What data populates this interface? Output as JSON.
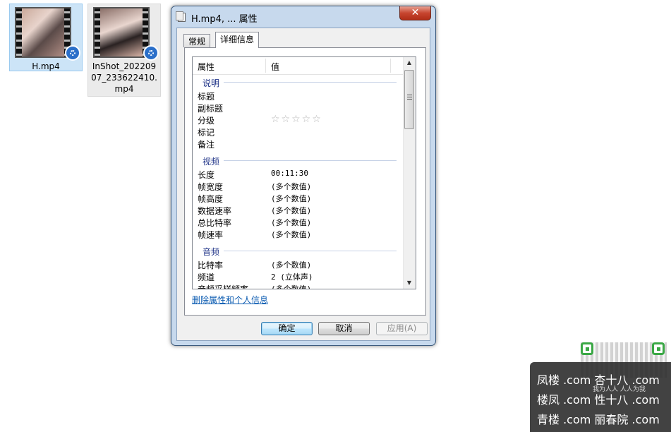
{
  "desktop": {
    "files": [
      {
        "name": "H.mp4"
      },
      {
        "name": "InShot_20220907_233622410.mp4"
      }
    ]
  },
  "dialog": {
    "title": "H.mp4, ... 属性",
    "close_label": "✕",
    "tabs": [
      {
        "label": "常规"
      },
      {
        "label": "详细信息"
      }
    ],
    "columns": {
      "property": "属性",
      "value": "值"
    },
    "groups": {
      "description": {
        "label": "说明",
        "rows": [
          {
            "key": "标题",
            "value": ""
          },
          {
            "key": "副标题",
            "value": ""
          },
          {
            "key": "分级",
            "value": "☆☆☆☆☆"
          },
          {
            "key": "标记",
            "value": ""
          },
          {
            "key": "备注",
            "value": ""
          }
        ]
      },
      "video": {
        "label": "视频",
        "rows": [
          {
            "key": "长度",
            "value": "00:11:30"
          },
          {
            "key": "帧宽度",
            "value": "(多个数值)"
          },
          {
            "key": "帧高度",
            "value": "(多个数值)"
          },
          {
            "key": "数据速率",
            "value": "(多个数值)"
          },
          {
            "key": "总比特率",
            "value": "(多个数值)"
          },
          {
            "key": "帧速率",
            "value": "(多个数值)"
          }
        ]
      },
      "audio": {
        "label": "音频",
        "rows": [
          {
            "key": "比特率",
            "value": "(多个数值)"
          },
          {
            "key": "频道",
            "value": "2 (立体声)"
          },
          {
            "key": "音频采样频率",
            "value": "(多个数值)"
          }
        ]
      }
    },
    "remove_link": "删除属性和个人信息",
    "buttons": {
      "ok": "确定",
      "cancel": "取消",
      "apply": "应用(A)"
    }
  },
  "watermark": {
    "qr_caption": "我为人人 人人为我",
    "lines": [
      "凤楼 .com  杏十八 .com",
      "楼凤 .com  性十八 .com",
      "青楼 .com  丽春院 .com"
    ]
  }
}
